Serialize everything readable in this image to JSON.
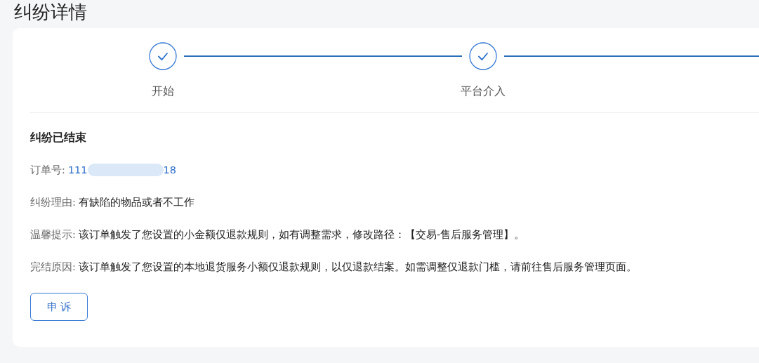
{
  "page": {
    "title": "纠纷详情"
  },
  "steps": [
    {
      "label": "开始",
      "done": true
    },
    {
      "label": "平台介入",
      "done": true
    }
  ],
  "status": {
    "title": "纠纷已结束"
  },
  "details": [
    {
      "kind": "order",
      "label": "订单号:",
      "value_start": "111",
      "value_end": "18",
      "redacted": true
    },
    {
      "kind": "text",
      "label": "纠纷理由:",
      "value": "有缺陷的物品或者不工作"
    },
    {
      "kind": "text",
      "label": "温馨提示:",
      "value": "该订单触发了您设置的小金额仅退款规则，如有调整需求，修改路径：【交易-售后服务管理】。"
    },
    {
      "kind": "text",
      "label": "完结原因:",
      "value": "该订单触发了您设置的本地退货服务小额仅退款规则，以仅退款结案。如需调整仅退款门槛，请前往售后服务管理页面。"
    }
  ],
  "buttons": [
    {
      "label": "申 诉"
    }
  ]
}
